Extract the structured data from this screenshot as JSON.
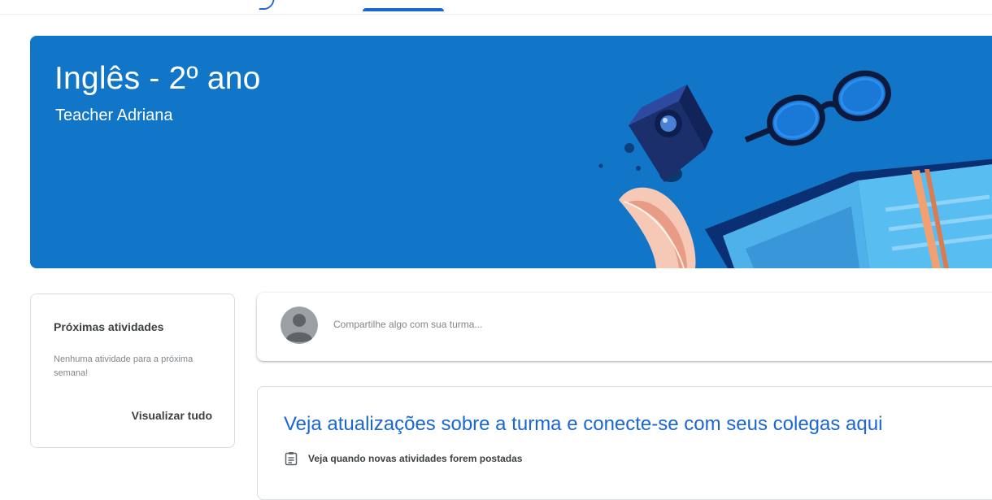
{
  "class": {
    "title": "Inglês - 2º ano",
    "teacher": "Teacher Adriana"
  },
  "upcoming": {
    "title": "Próximas atividades",
    "empty_message": "Nenhuma atividade para a próxima semana!",
    "view_all": "Visualizar tudo"
  },
  "share": {
    "placeholder": "Compartilhe algo com sua turma..."
  },
  "stream_info": {
    "heading": "Veja atualizações sobre a turma e conecte-se com seus colegas aqui",
    "items": [
      {
        "icon": "assignment-icon",
        "text": "Veja quando novas atividades forem postadas"
      }
    ]
  },
  "colors": {
    "banner": "#1175c8",
    "accent": "#1967d2"
  }
}
